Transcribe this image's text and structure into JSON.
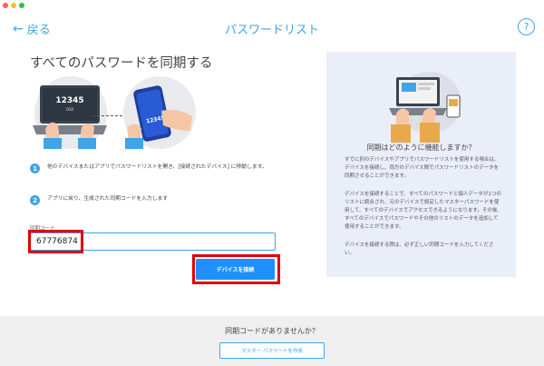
{
  "header": {
    "back_label": "戻る",
    "title": "パスワードリスト",
    "help_label": "?"
  },
  "main": {
    "heading": "すべてのパスワードを同期する",
    "illustration_laptop_number": "12345",
    "illustration_laptop_sub": "DSB",
    "illustration_phone_number": "12345",
    "steps": [
      {
        "num": "1",
        "text": "他のデバイスまたはアプリでパスワードリストを開き、[接続されたデバイス] に移動します。"
      },
      {
        "num": "2",
        "text": "アプリに戻り、生成された同期コードを入力します"
      }
    ],
    "sync_code_label": "同期コード",
    "sync_code_value": "67776874",
    "connect_button": "デバイスを接続"
  },
  "info": {
    "title": "同期はどのように機能しますか？",
    "paragraphs": [
      "すでに別のデバイスやアプリでパスワードリストを使用する場合は、デバイスを接続し、両方のデバイス間でパスワードリストのデータを同期させることができます。",
      "デバイスを接続することで、すべてのパスワードと個人データが1つのリストに統合され、元のデバイスで設定したマスターパスワードを使用して、すべてのデバイスでアクセスできるようになります。その後、すべてのデバイスでパスワードやその他のリストのデータを追加して使用することができます。",
      "デバイスを接続する際は、必ず正しい同期コードを入力してください。"
    ]
  },
  "footer": {
    "question": "同期コードがありませんか？",
    "create_button": "マスター パスワードを作成"
  },
  "colors": {
    "accent": "#3fa4e8",
    "button_blue": "#1e90ff",
    "highlight_red": "#e00000",
    "panel_bg": "#eaeef8",
    "footer_bg": "#efefef"
  }
}
